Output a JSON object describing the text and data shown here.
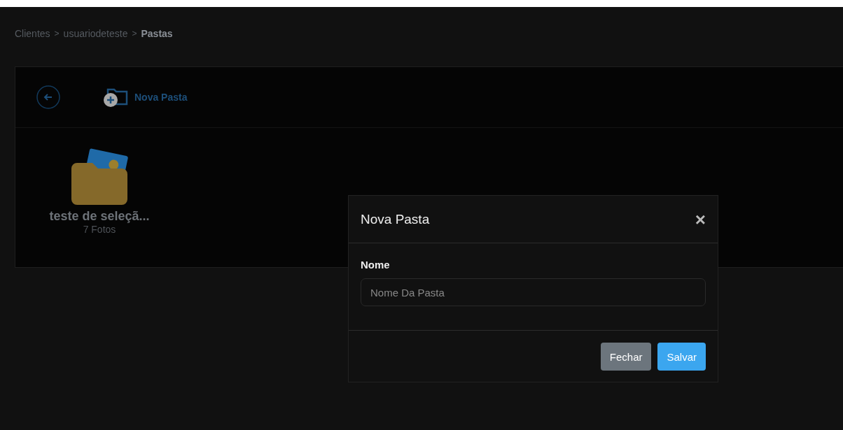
{
  "breadcrumb": [
    {
      "label": "Clientes",
      "current": false
    },
    {
      "label": "usuariodeteste",
      "current": false
    },
    {
      "label": "Pastas",
      "current": true
    }
  ],
  "breadcrumb_separator": ">",
  "toolbar": {
    "new_folder_label": "Nova Pasta"
  },
  "folders": [
    {
      "name": "teste de seleçã...",
      "count": "7 Fotos"
    }
  ],
  "modal": {
    "title": "Nova Pasta",
    "close": "×",
    "field_label": "Nome",
    "placeholder": "Nome Da Pasta",
    "buttons": [
      {
        "label": "Fechar",
        "kind": "secondary"
      },
      {
        "label": "Salvar",
        "kind": "primary"
      }
    ]
  }
}
